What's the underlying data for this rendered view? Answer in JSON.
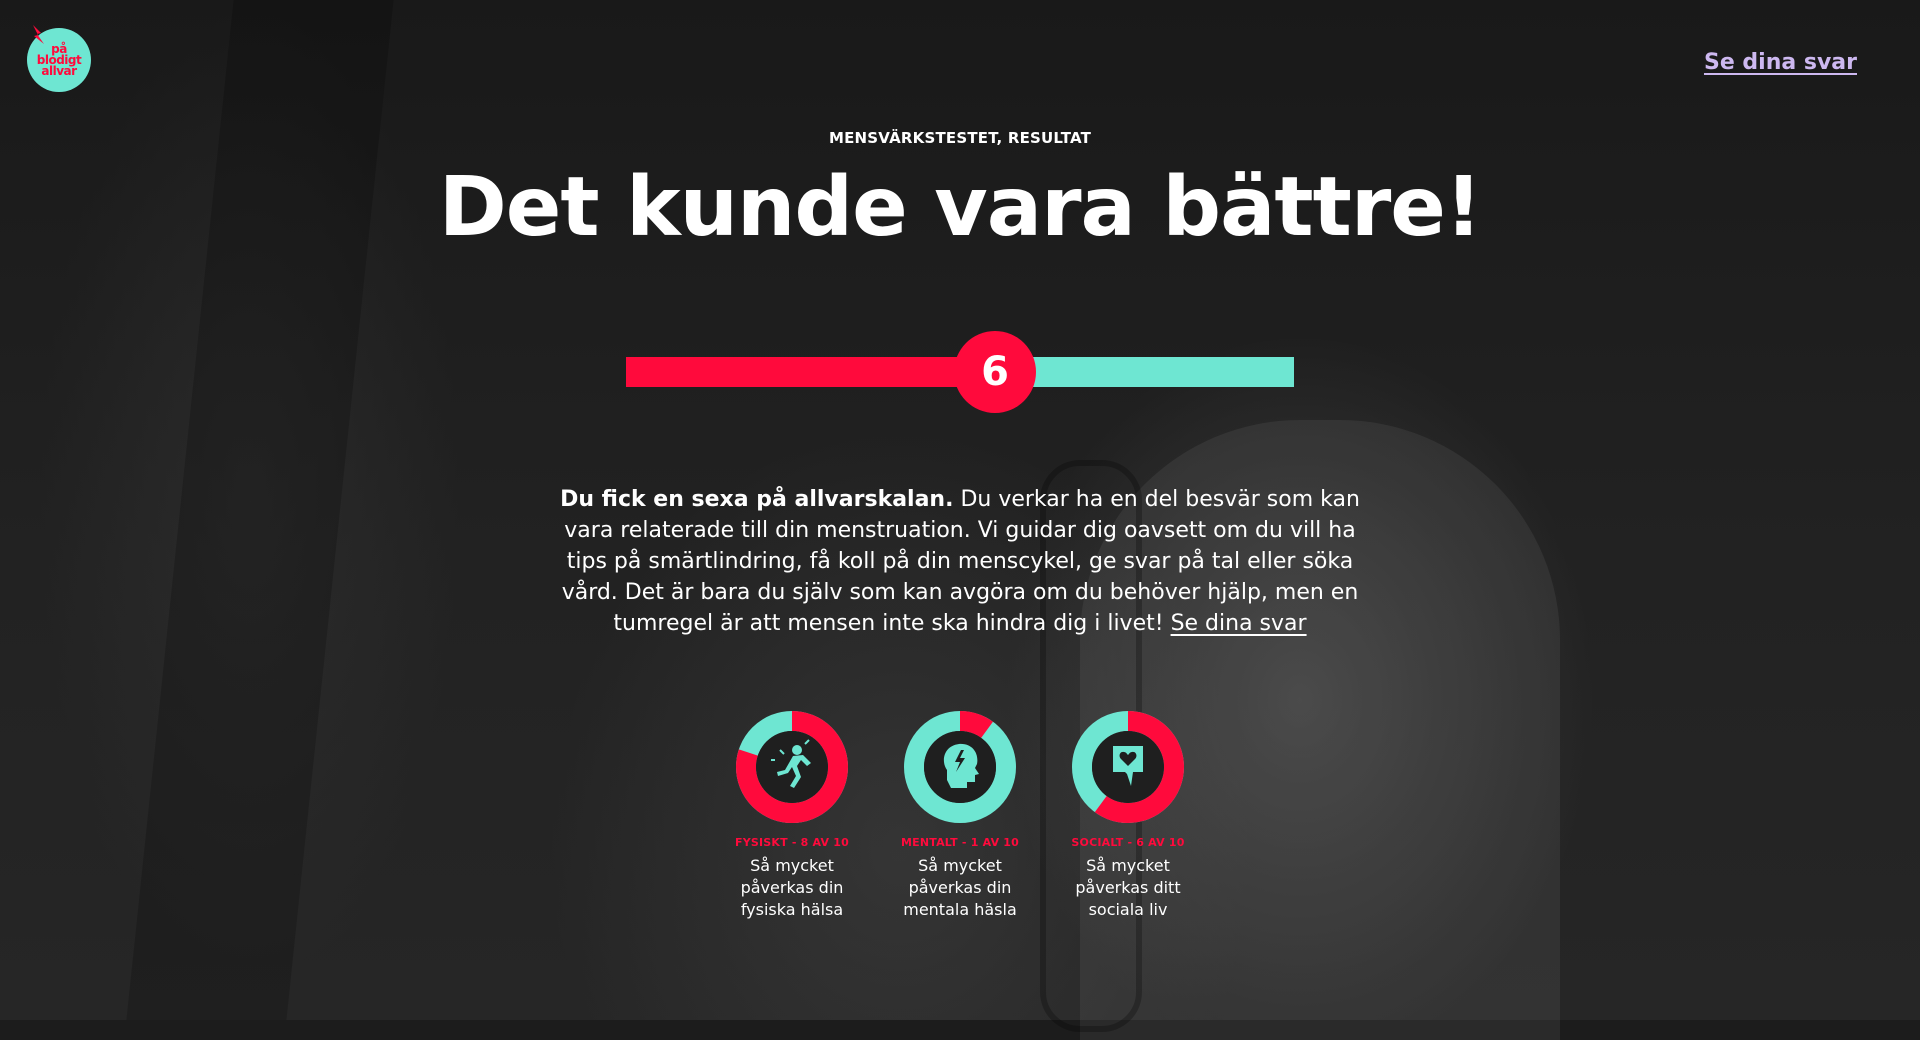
{
  "logo": {
    "lines": [
      "på",
      "blodigt",
      "allvar"
    ],
    "icon": "lightning-bolt-icon"
  },
  "header": {
    "answers_link": "Se dina svar"
  },
  "hero": {
    "eyebrow": "MENSVÄRKSTESTET, RESULTAT",
    "title": "Det kunde vara bättre!"
  },
  "scale": {
    "score": 6,
    "min": 0,
    "max": 10,
    "label": "6"
  },
  "description": {
    "bold": "Du fick en sexa på allvarskalan.",
    "body": " Du verkar ha en del besvär som kan vara relaterade till din menstruation. Vi guidar dig oavsett om du vill ha tips på smärtlindring, få koll på din menscykel, ge svar på tal eller söka vård. Det är bara du själv som kan avgöra om du behöver hjälp, men en tumregel är att mensen inte ska hindra dig i livet! ",
    "link": "Se dina svar"
  },
  "categories": [
    {
      "title": "FYSISKT - 8 AV 10",
      "value": 8,
      "max": 10,
      "icon": "running-person-icon",
      "lines": [
        "Så mycket",
        "påverkas din",
        "fysiska hälsa"
      ]
    },
    {
      "title": "MENTALT - 1 AV 10",
      "value": 1,
      "max": 10,
      "icon": "head-lightning-icon",
      "lines": [
        "Så mycket",
        "påverkas din",
        "mentala häsla"
      ]
    },
    {
      "title": "SOCIALT - 6 AV 10",
      "value": 6,
      "max": 10,
      "icon": "speech-heart-icon",
      "lines": [
        "Så mycket",
        "påverkas ditt",
        "sociala liv"
      ]
    }
  ],
  "colors": {
    "red": "#ff0a3c",
    "teal": "#6ee6d2",
    "lavender": "#cdb8f0",
    "dark": "#1c1c1c"
  }
}
